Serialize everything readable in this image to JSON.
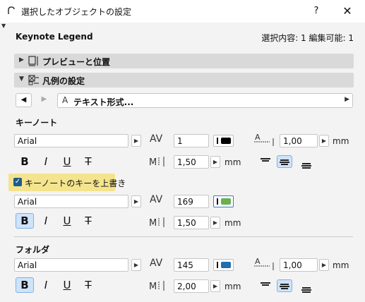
{
  "window": {
    "title": "選択したオブジェクトの設定",
    "help_label": "?",
    "close_label": "✕"
  },
  "header": {
    "title": "Keynote Legend",
    "status": "選択内容: 1 編集可能: 1"
  },
  "sections": {
    "preview": {
      "label": "プレビューと位置",
      "expanded": false
    },
    "legend": {
      "label": "凡例の設定",
      "expanded": true
    }
  },
  "text_style": {
    "label": "テキスト形式..."
  },
  "keynote": {
    "title": "キーノート",
    "font": "Arial",
    "pen": "1",
    "pen_color": "#000000",
    "size": "1,50",
    "size_unit": "mm",
    "width_factor": "1,00",
    "width_unit": "mm",
    "bold": false,
    "italic": false,
    "underline": false,
    "strike": false,
    "alignment": "center"
  },
  "override": {
    "checked": true,
    "label": "キーノートのキーを上書き",
    "font": "Arial",
    "pen": "169",
    "pen_color": "#6ab04c",
    "size": "1,50",
    "size_unit": "mm",
    "bold": true,
    "italic": false,
    "underline": false,
    "strike": false
  },
  "folder": {
    "title": "フォルダ",
    "font": "Arial",
    "pen": "145",
    "pen_color": "#1f6fae",
    "size": "2,00",
    "size_unit": "mm",
    "width_factor": "1,00",
    "width_unit": "mm",
    "bold": true,
    "italic": false,
    "underline": false,
    "strike": false,
    "alignment": "center"
  },
  "format_labels": {
    "bold": "B",
    "italic": "I",
    "underline": "U",
    "strike": "T"
  },
  "icons": {
    "pen": "AV",
    "size": "M",
    "width": "A"
  }
}
